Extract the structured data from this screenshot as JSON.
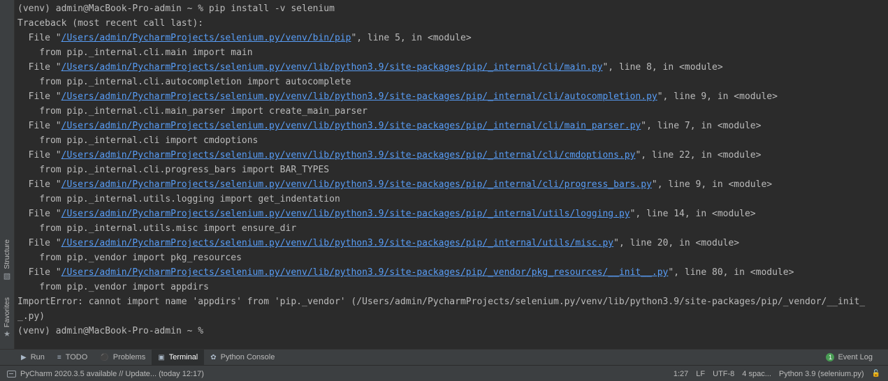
{
  "terminal": {
    "lines": [
      {
        "type": "text",
        "text": "(venv) admin@MacBook-Pro-admin ~ % pip install -v selenium"
      },
      {
        "type": "text",
        "text": "Traceback (most recent call last):"
      },
      {
        "type": "file",
        "prefix": "  File \"",
        "path": "/Users/admin/PycharmProjects/selenium.py/venv/bin/pip",
        "suffix": "\", line 5, in <module>"
      },
      {
        "type": "text",
        "text": "    from pip._internal.cli.main import main"
      },
      {
        "type": "file",
        "prefix": "  File \"",
        "path": "/Users/admin/PycharmProjects/selenium.py/venv/lib/python3.9/site-packages/pip/_internal/cli/main.py",
        "suffix": "\", line 8, in <module>"
      },
      {
        "type": "text",
        "text": "    from pip._internal.cli.autocompletion import autocomplete"
      },
      {
        "type": "file",
        "prefix": "  File \"",
        "path": "/Users/admin/PycharmProjects/selenium.py/venv/lib/python3.9/site-packages/pip/_internal/cli/autocompletion.py",
        "suffix": "\", line 9, in <module>"
      },
      {
        "type": "text",
        "text": "    from pip._internal.cli.main_parser import create_main_parser"
      },
      {
        "type": "file",
        "prefix": "  File \"",
        "path": "/Users/admin/PycharmProjects/selenium.py/venv/lib/python3.9/site-packages/pip/_internal/cli/main_parser.py",
        "suffix": "\", line 7, in <module>"
      },
      {
        "type": "text",
        "text": "    from pip._internal.cli import cmdoptions"
      },
      {
        "type": "file",
        "prefix": "  File \"",
        "path": "/Users/admin/PycharmProjects/selenium.py/venv/lib/python3.9/site-packages/pip/_internal/cli/cmdoptions.py",
        "suffix": "\", line 22, in <module>"
      },
      {
        "type": "text",
        "text": "    from pip._internal.cli.progress_bars import BAR_TYPES"
      },
      {
        "type": "file",
        "prefix": "  File \"",
        "path": "/Users/admin/PycharmProjects/selenium.py/venv/lib/python3.9/site-packages/pip/_internal/cli/progress_bars.py",
        "suffix": "\", line 9, in <module>"
      },
      {
        "type": "text",
        "text": "    from pip._internal.utils.logging import get_indentation"
      },
      {
        "type": "file",
        "prefix": "  File \"",
        "path": "/Users/admin/PycharmProjects/selenium.py/venv/lib/python3.9/site-packages/pip/_internal/utils/logging.py",
        "suffix": "\", line 14, in <module>"
      },
      {
        "type": "text",
        "text": "    from pip._internal.utils.misc import ensure_dir"
      },
      {
        "type": "file",
        "prefix": "  File \"",
        "path": "/Users/admin/PycharmProjects/selenium.py/venv/lib/python3.9/site-packages/pip/_internal/utils/misc.py",
        "suffix": "\", line 20, in <module>"
      },
      {
        "type": "text",
        "text": "    from pip._vendor import pkg_resources"
      },
      {
        "type": "file",
        "prefix": "  File \"",
        "path": "/Users/admin/PycharmProjects/selenium.py/venv/lib/python3.9/site-packages/pip/_vendor/pkg_resources/__init__.py",
        "suffix": "\", line 80, in <module>"
      },
      {
        "type": "text",
        "text": "    from pip._vendor import appdirs"
      },
      {
        "type": "text",
        "text": "ImportError: cannot import name 'appdirs' from 'pip._vendor' (/Users/admin/PycharmProjects/selenium.py/venv/lib/python3.9/site-packages/pip/_vendor/__init_"
      },
      {
        "type": "text",
        "text": "_.py)"
      },
      {
        "type": "text",
        "text": "(venv) admin@MacBook-Pro-admin ~ % "
      }
    ]
  },
  "side_strip": {
    "structure": {
      "label": "Structure",
      "icon": "structure-icon"
    },
    "favorites": {
      "label": "Favorites",
      "icon": "star-icon"
    }
  },
  "tool_tabs": {
    "run": {
      "label": "Run",
      "icon": "play-icon"
    },
    "todo": {
      "label": "TODO",
      "icon": "list-icon"
    },
    "problems": {
      "label": "Problems",
      "icon": "problems-icon"
    },
    "terminal": {
      "label": "Terminal",
      "icon": "terminal-icon"
    },
    "python_console": {
      "label": "Python Console",
      "icon": "python-icon"
    }
  },
  "event_log": {
    "label": "Event Log",
    "badge": "1"
  },
  "status": {
    "message": "PyCharm 2020.3.5 available // Update... (today 12:17)",
    "position": "1:27",
    "line_sep": "LF",
    "encoding": "UTF-8",
    "indent": "4 spac...",
    "interpreter": "Python 3.9 (selenium.py)"
  },
  "colors": {
    "background": "#2b2b2b",
    "text": "#bbbbbb",
    "link": "#589df6",
    "panel": "#3c3f41",
    "badge": "#499c54"
  }
}
